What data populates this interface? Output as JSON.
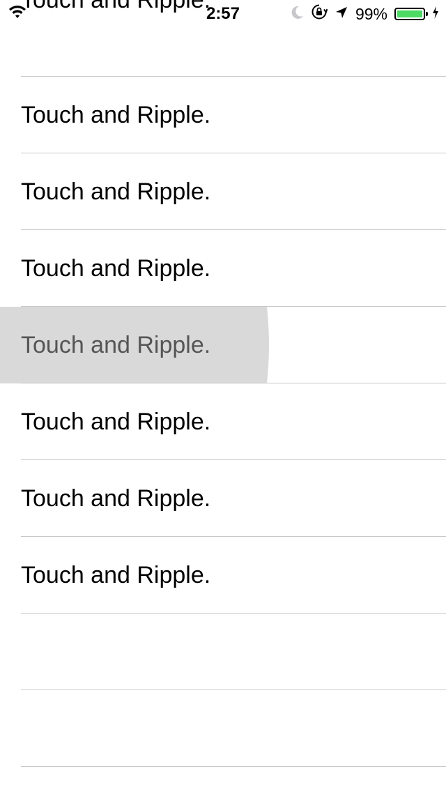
{
  "status_bar": {
    "time": "2:57",
    "battery_percent": "99%",
    "battery_level": 0.99,
    "icons": [
      "wifi-icon",
      "moon-icon",
      "rotation-lock-icon",
      "location-arrow-icon",
      "battery-icon",
      "charging-bolt-icon"
    ],
    "battery_color": "#4cd964"
  },
  "list": {
    "rows": [
      {
        "label": "Touch and Ripple."
      },
      {
        "label": "Touch and Ripple."
      },
      {
        "label": "Touch and Ripple."
      },
      {
        "label": "Touch and Ripple."
      },
      {
        "label": "Touch and Ripple."
      },
      {
        "label": "Touch and Ripple."
      },
      {
        "label": "Touch and Ripple."
      },
      {
        "label": "Touch and Ripple."
      },
      {
        "label": ""
      },
      {
        "label": ""
      }
    ],
    "pressed_row_index": 4,
    "ripple_color": "#d9d9d9",
    "separator_color": "#c8c7cc"
  }
}
